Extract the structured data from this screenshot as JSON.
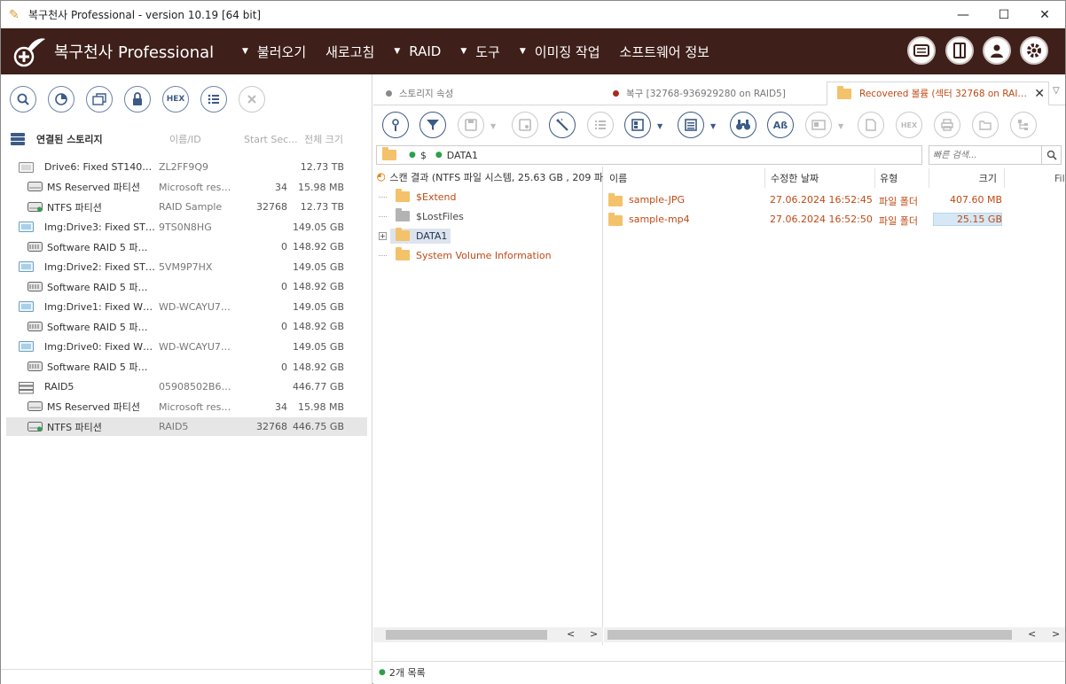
{
  "window": {
    "title": "복구천사 Professional - version 10.19 [64 bit]",
    "minimize": "—",
    "maximize": "☐",
    "close": "✕"
  },
  "menubar": {
    "logo_text": "복구천사 Professional",
    "items": [
      "불러오기",
      "새로고침",
      "RAID",
      "도구",
      "이미징 작업",
      "소프트웨어 정보"
    ],
    "item_arrows": [
      true,
      false,
      true,
      true,
      true,
      false
    ],
    "right_buttons": [
      "drive-icon",
      "panel-icon",
      "user-icon",
      "gear-icon"
    ]
  },
  "left_toolbar": {
    "buttons": [
      "search-icon",
      "scan-icon",
      "save-icon",
      "lock-icon",
      "HEX",
      "list-icon",
      "close-icon"
    ]
  },
  "storage": {
    "title": "연결된 스토리지",
    "col_name_id": "이름/ID",
    "col_start": "Start Sec...",
    "col_total": "전체 크기",
    "rows": [
      {
        "name": "Drive6: Fixed ST14000N...",
        "id": "ZL2FF9Q9",
        "start": "",
        "size": "12.73 TB",
        "type": "disk",
        "indent": 0
      },
      {
        "name": "MS Reserved 파티션",
        "id": "Microsoft rese...",
        "start": "34",
        "size": "15.98 MB",
        "type": "part",
        "indent": 1
      },
      {
        "name": "NTFS 파티션",
        "id": "RAID Sample",
        "start": "32768",
        "size": "12.73 TB",
        "type": "part-ok",
        "indent": 1
      },
      {
        "name": "Img:Drive3: Fixed ST31...",
        "id": "9TS0N8HG",
        "start": "",
        "size": "149.05 GB",
        "type": "img",
        "indent": 0
      },
      {
        "name": "Software RAID 5 파티션",
        "id": "",
        "start": "0",
        "size": "148.92 GB",
        "type": "raidpart",
        "indent": 1
      },
      {
        "name": "Img:Drive2: Fixed ST31...",
        "id": "5VM9P7HX",
        "start": "",
        "size": "149.05 GB",
        "type": "img",
        "indent": 0
      },
      {
        "name": "Software RAID 5 파티션",
        "id": "",
        "start": "0",
        "size": "148.92 GB",
        "type": "raidpart",
        "indent": 1
      },
      {
        "name": "Img:Drive1: Fixed WDC ...",
        "id": "WD-WCAYU70...",
        "start": "",
        "size": "149.05 GB",
        "type": "img",
        "indent": 0
      },
      {
        "name": "Software RAID 5 파티션",
        "id": "",
        "start": "0",
        "size": "148.92 GB",
        "type": "raidpart",
        "indent": 1
      },
      {
        "name": "Img:Drive0: Fixed WDC ...",
        "id": "WD-WCAYU70...",
        "start": "",
        "size": "149.05 GB",
        "type": "img",
        "indent": 0
      },
      {
        "name": "Software RAID 5 파티션",
        "id": "",
        "start": "0",
        "size": "148.92 GB",
        "type": "raidpart",
        "indent": 1
      },
      {
        "name": "RAID5",
        "id": "05908502B641...",
        "start": "",
        "size": "446.77 GB",
        "type": "raid",
        "indent": 0
      },
      {
        "name": "MS Reserved 파티션",
        "id": "Microsoft rese...",
        "start": "34",
        "size": "15.98 MB",
        "type": "part",
        "indent": 1
      },
      {
        "name": "NTFS 파티션",
        "id": "RAID5",
        "start": "32768",
        "size": "446.75 GB",
        "type": "part-ok",
        "indent": 1,
        "selected": true
      }
    ]
  },
  "tabs": [
    {
      "label": "스토리지 속성",
      "dot": "#8a8a8a",
      "active": false
    },
    {
      "label": "복구 [32768-936929280 on RAID5]",
      "dot": "#a52a1f",
      "active": false
    },
    {
      "label": "Recovered 볼륨 (섹터 32768 on RAID...",
      "dot": "folder",
      "active": true
    }
  ],
  "path": {
    "segments": [
      "$",
      "DATA1"
    ]
  },
  "search": {
    "placeholder": "빠른 검색..."
  },
  "tree": {
    "root": "스캔 결과 (NTFS 파일 시스템, 25.63 GB , 209 파",
    "nodes": [
      {
        "label": "$Extend",
        "grey": false,
        "selected": false,
        "expand": false
      },
      {
        "label": "$LostFiles",
        "grey": true,
        "selected": false,
        "expand": false
      },
      {
        "label": "DATA1",
        "grey": false,
        "selected": true,
        "expand": true
      },
      {
        "label": "System Volume Information",
        "grey": false,
        "selected": false,
        "expand": false
      }
    ]
  },
  "filelist": {
    "headers": {
      "name": "이름",
      "modified": "수정한 날짜",
      "type": "유형",
      "size": "크기",
      "extra": "Fil"
    },
    "rows": [
      {
        "name": "sample-JPG",
        "modified": "27.06.2024 16:52:45",
        "type": "파일 폴더",
        "size": "407.60 MB",
        "bar": false
      },
      {
        "name": "sample-mp4",
        "modified": "27.06.2024 16:52:50",
        "type": "파일 폴더",
        "size": "25.15 GB",
        "bar": true
      }
    ]
  },
  "status": {
    "text": "2개 목록"
  }
}
